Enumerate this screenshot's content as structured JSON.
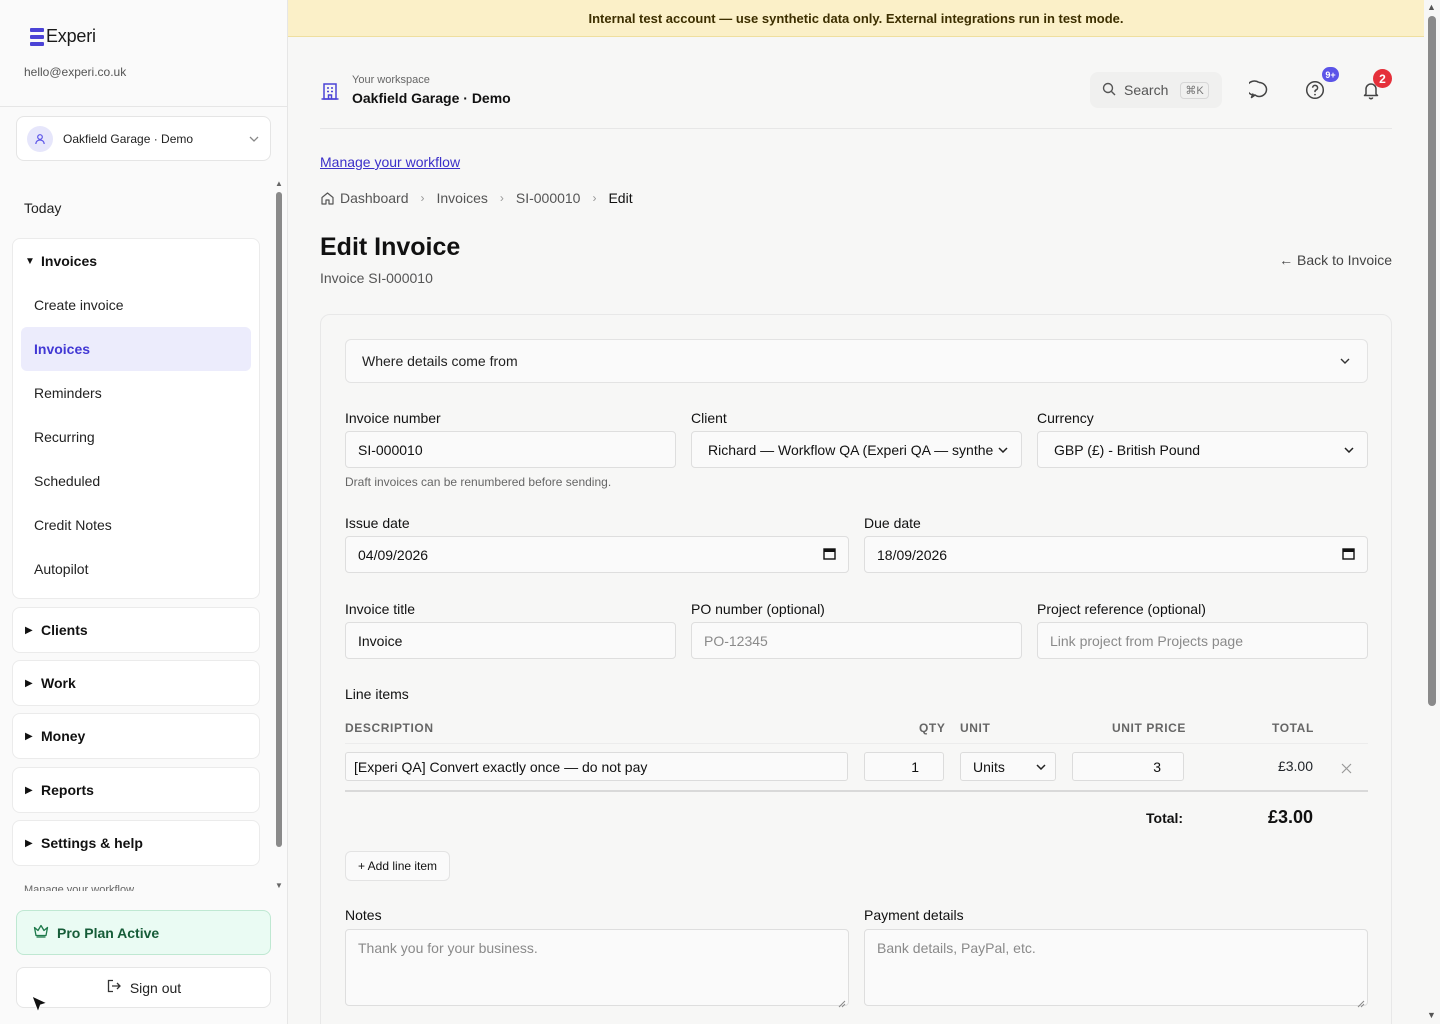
{
  "brand": {
    "name": "Experi",
    "email": "hello@experi.co.uk"
  },
  "workspace_switcher": {
    "name": "Oakfield Garage · Demo"
  },
  "sidebar": {
    "today": "Today",
    "invoices_group": {
      "label": "Invoices",
      "items": [
        "Create invoice",
        "Invoices",
        "Reminders",
        "Recurring",
        "Scheduled",
        "Credit Notes",
        "Autopilot"
      ],
      "active": "Invoices"
    },
    "groups": [
      "Clients",
      "Work",
      "Money",
      "Reports",
      "Settings & help"
    ],
    "clipped_text": "Manage your workflow",
    "pro_plan": "Pro Plan Active",
    "sign_out": "Sign out"
  },
  "banner": {
    "text": "Internal test account — use synthetic data only. External integrations run in test mode."
  },
  "header": {
    "workspace_label": "Your workspace",
    "workspace_name": "Oakfield Garage · Demo",
    "search_label": "Search",
    "search_shortcut": "⌘K",
    "help_badge": "9+",
    "notifications_badge": "2"
  },
  "page": {
    "manage_link": "Manage your workflow",
    "breadcrumbs": [
      "Dashboard",
      "Invoices",
      "SI-000010",
      "Edit"
    ],
    "title": "Edit Invoice",
    "subtitle": "Invoice SI-000010",
    "back_link": "← Back to Invoice"
  },
  "form": {
    "details_source": "Where details come from",
    "invoice_number": {
      "label": "Invoice number",
      "value": "SI-000010",
      "hint": "Draft invoices can be renumbered before sending."
    },
    "client": {
      "label": "Client",
      "value": "Richard — Workflow QA (Experi QA — synthe"
    },
    "currency": {
      "label": "Currency",
      "value": "GBP (£) - British Pound"
    },
    "issue_date": {
      "label": "Issue date",
      "value": "04/09/2026"
    },
    "due_date": {
      "label": "Due date",
      "value": "18/09/2026"
    },
    "invoice_title": {
      "label": "Invoice title",
      "value": "Invoice"
    },
    "po_number": {
      "label": "PO number (optional)",
      "placeholder": "PO-12345"
    },
    "project_ref": {
      "label": "Project reference (optional)",
      "placeholder": "Link project from Projects page"
    },
    "line_items": {
      "label": "Line items",
      "columns": {
        "description": "DESCRIPTION",
        "qty": "QTY",
        "unit": "UNIT",
        "unit_price": "UNIT PRICE",
        "total": "TOTAL"
      },
      "rows": [
        {
          "description": "[Experi QA] Convert exactly once — do not pay",
          "qty": "1",
          "unit": "Units",
          "unit_price": "3",
          "total": "£3.00"
        }
      ],
      "total_label": "Total:",
      "total_value": "£3.00",
      "add_label": "+ Add line item"
    },
    "notes": {
      "label": "Notes",
      "placeholder": "Thank you for your business."
    },
    "payment_details": {
      "label": "Payment details",
      "placeholder": "Bank details, PayPal, etc."
    }
  },
  "colors": {
    "accent": "#4b43d6",
    "banner": "#fbf0c8",
    "pro_bg": "#eafbf3",
    "badge_red": "#e5303a",
    "badge_purple": "#5b54e8"
  }
}
